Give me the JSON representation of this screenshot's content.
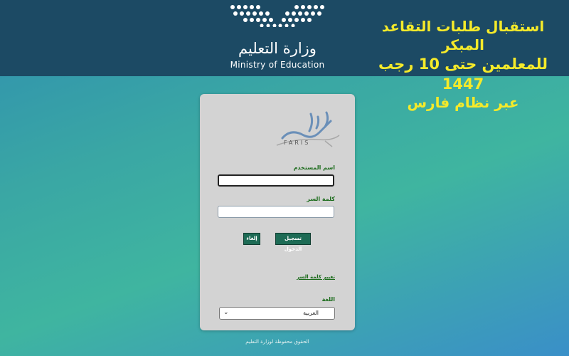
{
  "header": {
    "ministry_ar": "وزارة التعليم",
    "ministry_en": "Ministry of Education",
    "headline": {
      "line1": "استقبال طلبات التقاعد المبكر",
      "line2": "للمعلمين حتى 10 رجب 1447",
      "line3": "عبر  نظام فارس"
    }
  },
  "login": {
    "logo_text": "FARIS",
    "username_label": "اسم المستخدم",
    "username_value": "",
    "password_label": "كلمة السر",
    "password_value": "",
    "login_button": "تسجيل الدخول",
    "cancel_button": "إلغاء",
    "change_password_link": "تغيير كلمة السر",
    "language_label": "اللغة",
    "language_selected": "العربية"
  },
  "footer": {
    "text": "الحقوق محفوظة لوزارة التعليم"
  },
  "colors": {
    "topbar": "#1c4a64",
    "headline": "#f5ea2a",
    "button": "#1d6b55",
    "label": "#1a6b1a"
  }
}
